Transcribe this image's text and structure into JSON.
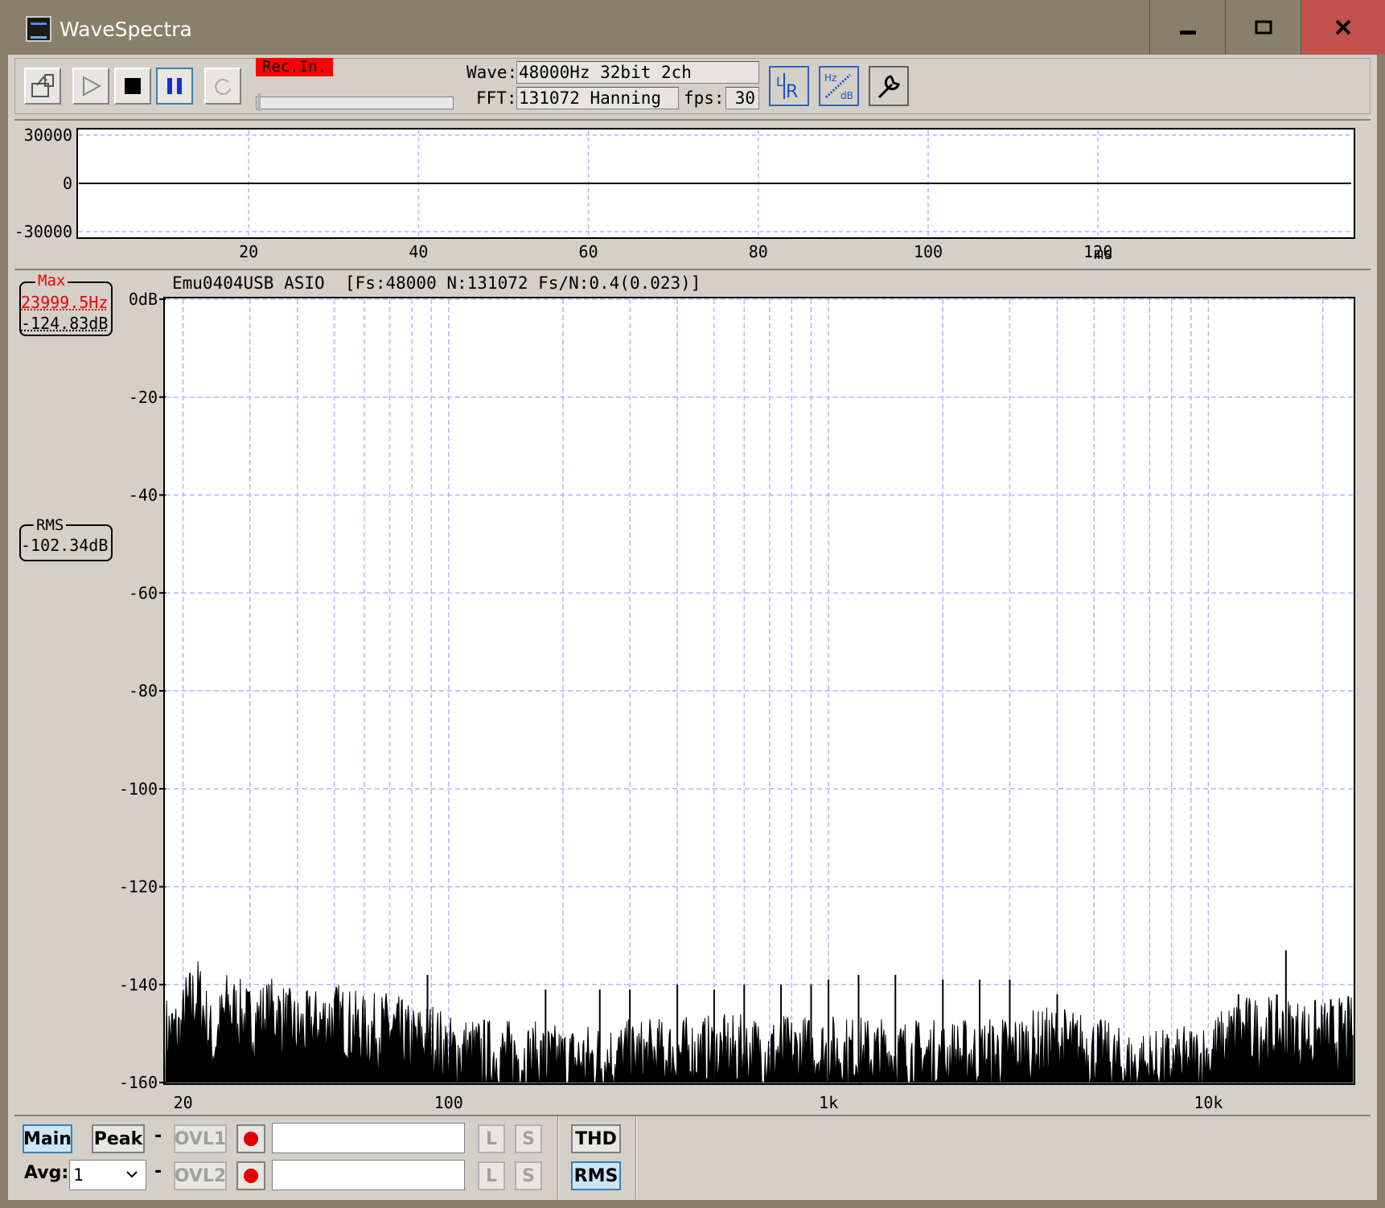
{
  "window": {
    "title": "WaveSpectra"
  },
  "toolbar": {
    "rec_label": "Rec.In.",
    "wave_label": "Wave:",
    "wave_value": "48000Hz 32bit 2ch",
    "fft_label": "FFT:",
    "fft_value": "131072 Hanning",
    "fps_label": "fps:",
    "fps_value": "30"
  },
  "waveform": {
    "y_ticks": [
      "30000",
      "0",
      "-30000"
    ],
    "x_ticks": [
      "20",
      "40",
      "60",
      "80",
      "100",
      "120"
    ],
    "x_unit": "ms"
  },
  "spectrum": {
    "header": "Emu0404USB ASIO  [Fs:48000 N:131072 Fs/N:0.4(0.023)]",
    "max_title": "Max",
    "max_hz": "23999.5Hz",
    "max_db": "-124.83dB",
    "rms_title": "RMS",
    "rms_db": "-102.34dB",
    "y_ticks": [
      "0dB",
      "-20",
      "-40",
      "-60",
      "-80",
      "-100",
      "-120",
      "-140",
      "-160"
    ],
    "x_ticks": [
      "20",
      "100",
      "1k",
      "10k"
    ]
  },
  "bottom": {
    "main_label": "Main",
    "peak_label": "Peak",
    "ovl1_label": "OVL1",
    "ovl2_label": "OVL2",
    "avg_label": "Avg:",
    "avg_value": "1",
    "l_label": "L",
    "s_label": "S",
    "thd_label": "THD",
    "rms_label": "RMS",
    "dash": "-"
  },
  "colors": {
    "titlebar": "#8a7f6a",
    "close": "#c2514d",
    "rec": "#ff0000",
    "grid": "#b4b4ff",
    "max_text": "#e00000"
  },
  "chart_data": {
    "type": "area",
    "xscale": "log",
    "xlim": [
      18,
      24000
    ],
    "ylim": [
      -160,
      0
    ],
    "ylabel": "",
    "xlabel": "",
    "series": [
      {
        "values": [
          [
            20,
            -146
          ],
          [
            22,
            -142
          ],
          [
            24,
            -153
          ],
          [
            26,
            -145
          ],
          [
            30,
            -148
          ],
          [
            35,
            -146
          ],
          [
            40,
            -150
          ],
          [
            50,
            -147
          ],
          [
            60,
            -150
          ],
          [
            70,
            -149
          ],
          [
            80,
            -152
          ],
          [
            90,
            -151
          ],
          [
            100,
            -154
          ],
          [
            150,
            -155
          ],
          [
            200,
            -156
          ],
          [
            300,
            -155
          ],
          [
            500,
            -154
          ],
          [
            1000,
            -154
          ],
          [
            2000,
            -155
          ],
          [
            3000,
            -154
          ],
          [
            4000,
            -152
          ],
          [
            5000,
            -154
          ],
          [
            6000,
            -157
          ],
          [
            8000,
            -157
          ],
          [
            10000,
            -155
          ],
          [
            12000,
            -150
          ],
          [
            15000,
            -150
          ],
          [
            20000,
            -151
          ],
          [
            24000,
            -150
          ]
        ]
      }
    ],
    "spikes": [
      [
        88,
        -138
      ],
      [
        180,
        -141
      ],
      [
        250,
        -141
      ],
      [
        300,
        -141
      ],
      [
        400,
        -140
      ],
      [
        500,
        -141
      ],
      [
        600,
        -140
      ],
      [
        750,
        -140
      ],
      [
        900,
        -140
      ],
      [
        1000,
        -139
      ],
      [
        1200,
        -138
      ],
      [
        1500,
        -138
      ],
      [
        2000,
        -139
      ],
      [
        2500,
        -139
      ],
      [
        3000,
        -139
      ],
      [
        4000,
        -142
      ],
      [
        12000,
        -142
      ],
      [
        16000,
        -133
      ],
      [
        21000,
        -143
      ]
    ]
  }
}
